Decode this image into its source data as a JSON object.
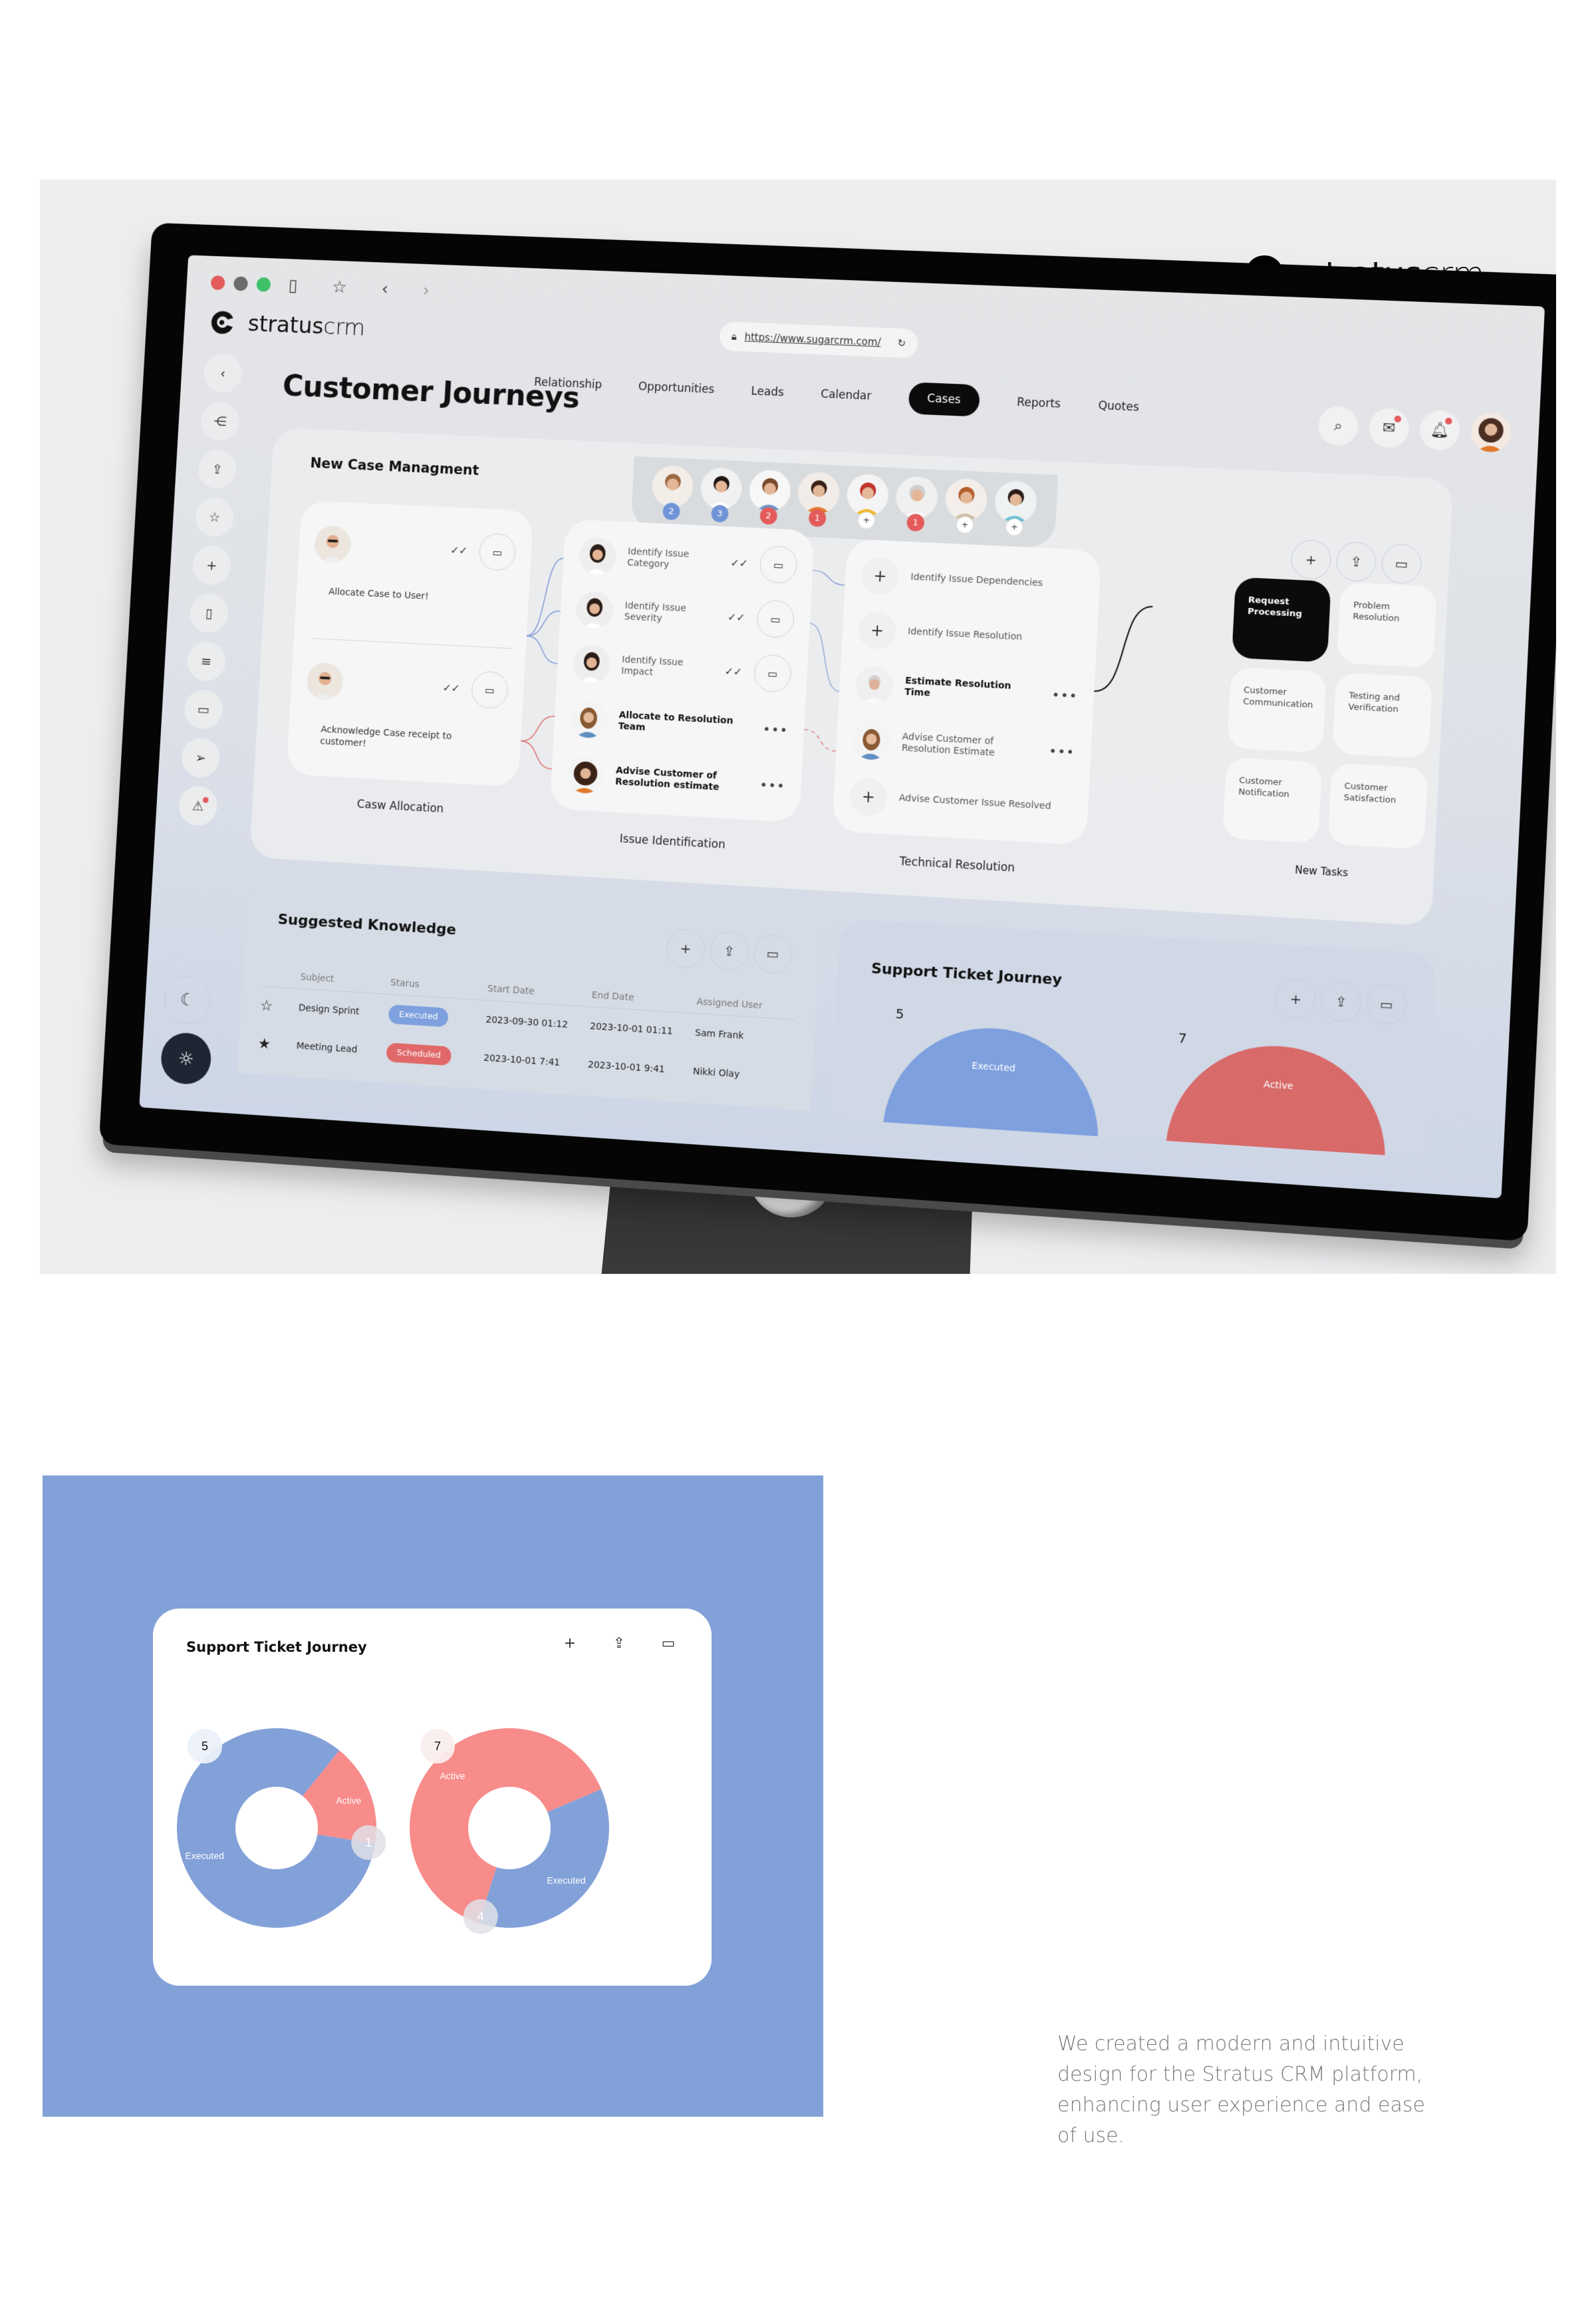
{
  "brand": {
    "name_bold": "stratus",
    "name_light": "crm"
  },
  "browser": {
    "url": "https://www.sugarcrm.com/",
    "traffic_lights": [
      "#E25C5C",
      "#6B6B6B",
      "#3FC06A"
    ]
  },
  "app": {
    "logo": {
      "name_bold": "stratus",
      "name_light": "crm"
    },
    "nav": [
      {
        "label": "Relationship",
        "active": false
      },
      {
        "label": "Opportunities",
        "active": false
      },
      {
        "label": "Leads",
        "active": false
      },
      {
        "label": "Calendar",
        "active": false
      },
      {
        "label": "Cases",
        "active": true
      },
      {
        "label": "Reports",
        "active": false
      },
      {
        "label": "Quotes",
        "active": false
      }
    ],
    "page_title": "Customer Journeys",
    "top_actions": [
      "search-icon",
      "mail-icon",
      "bell-icon",
      "user-avatar"
    ],
    "sidebar": [
      "back-icon",
      "share-icon",
      "upload-icon",
      "star-icon",
      "plus-icon",
      "phone-icon",
      "database-icon",
      "calendar-icon",
      "send-icon",
      "alert-icon"
    ],
    "theme_toggle": {
      "dark": "moon-icon",
      "light": "sun-icon",
      "selected": "light"
    }
  },
  "case_management": {
    "title": "New Case Managment",
    "team": [
      {
        "badge": "2",
        "badge_type": "blue"
      },
      {
        "badge": "3",
        "badge_type": "blue"
      },
      {
        "badge": "2",
        "badge_type": "red"
      },
      {
        "badge": "1",
        "badge_type": "red"
      },
      {
        "badge": "+",
        "badge_type": "plus"
      },
      {
        "badge": "1",
        "badge_type": "red"
      },
      {
        "badge": "+",
        "badge_type": "plus"
      },
      {
        "badge": "+",
        "badge_type": "plus"
      }
    ],
    "columns": [
      {
        "label": "Casw Allocation",
        "tasks": [
          {
            "text": "Allocate Case to User!",
            "avatar": true,
            "done": true
          },
          {
            "text": "Acknowledge Case receipt to customer!",
            "avatar": true,
            "done": true
          }
        ]
      },
      {
        "label": "Issue Identification",
        "tasks": [
          {
            "text": "Identify Issue Category",
            "avatar": true,
            "done": true,
            "bold": false
          },
          {
            "text": "Identify Issue Severity",
            "avatar": true,
            "done": true,
            "bold": false
          },
          {
            "text": "Identify Issue Impact",
            "avatar": true,
            "done": true,
            "bold": false
          },
          {
            "text": "Allocate to Resolution Team",
            "avatar": true,
            "done": false,
            "bold": true
          },
          {
            "text": "Advise Customer of Resolution estimate",
            "avatar": true,
            "done": false,
            "bold": true
          }
        ]
      },
      {
        "label": "Technical Resolution",
        "tasks": [
          {
            "text": "Identify Issue Dependencies",
            "avatar": false,
            "bold": false
          },
          {
            "text": "Identify Issue Resolution",
            "avatar": false,
            "bold": false
          },
          {
            "text": "Estimate Resolution Time",
            "avatar": true,
            "bold": true
          },
          {
            "text": "Advise Customer of Resolution Estimate",
            "avatar": true,
            "bold": false
          },
          {
            "text": "Advise Customer Issue Resolved",
            "avatar": false,
            "bold": false
          }
        ]
      }
    ],
    "new_tasks": {
      "label": "New Tasks",
      "tiles": [
        {
          "text": "Request Processing",
          "selected": true
        },
        {
          "text": "Problem Resolution",
          "selected": false
        },
        {
          "text": "Customer Communication",
          "selected": false
        },
        {
          "text": "Testing and Verification",
          "selected": false
        },
        {
          "text": "Customer Notification",
          "selected": false
        },
        {
          "text": "Customer Satisfaction",
          "selected": false
        }
      ]
    },
    "panel_actions": [
      "plus-icon",
      "share-icon",
      "calendar-icon"
    ]
  },
  "suggested_knowledge": {
    "title": "Suggested Knowledge",
    "columns": [
      "Subject",
      "Starus",
      "Start Date",
      "End Date",
      "Assigned User"
    ],
    "rows": [
      {
        "starred": false,
        "subject": "Design Sprint",
        "status": "Executed",
        "start": "2023-09-30 01:12",
        "end": "2023-10-01 01:11",
        "user": "Sam Frank"
      },
      {
        "starred": true,
        "subject": "Meeting Lead",
        "status": "Scheduled",
        "start": "2023-10-01 7:41",
        "end": "2023-10-01 9:41",
        "user": "Nikki Olay"
      }
    ]
  },
  "support_ticket_journey": {
    "title": "Support Ticket Journey",
    "actions": [
      "plus-icon",
      "share-icon",
      "calendar-icon"
    ]
  },
  "colors": {
    "executed": "#83A1D9",
    "active": "#F78C8A",
    "accent_dark": "#0B0B0B",
    "panel_blue": "#83A1D9"
  },
  "chart_data": [
    {
      "type": "pie",
      "title": "Support Ticket Journey",
      "donut": true,
      "total_label": "5",
      "slices": [
        {
          "label": "Executed",
          "value": 5,
          "color": "#83A1D9"
        },
        {
          "label": "Active",
          "value": 1,
          "color": "#F78C8A"
        }
      ]
    },
    {
      "type": "pie",
      "title": "Support Ticket Journey",
      "donut": true,
      "total_label": "7",
      "slices": [
        {
          "label": "Active",
          "value": 7,
          "color": "#F78C8A"
        },
        {
          "label": "Executed",
          "value": 4,
          "color": "#83A1D9"
        }
      ]
    }
  ],
  "description": "We created a modern and intuitive design for the Stratus CRM platform, enhancing user experience and ease of use."
}
